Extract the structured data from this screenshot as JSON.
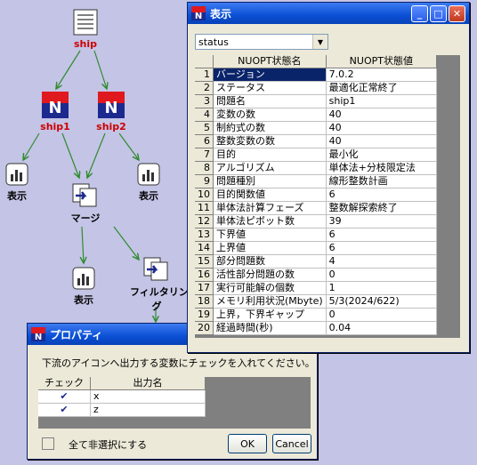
{
  "nodes": {
    "ship": "ship",
    "ship1": "ship1",
    "ship2": "ship2",
    "display_left": "表示",
    "display_right": "表示",
    "merge": "マージ",
    "display_bottom": "表示",
    "filtering_line1": "フィルタリン",
    "filtering_line2": "グ"
  },
  "display_window": {
    "title": "表示",
    "dropdown_value": "status",
    "columns": [
      "NUOPT状態名",
      "NUOPT状態値"
    ],
    "rows": [
      {
        "n": "1",
        "name": "バージョン",
        "value": "7.0.2"
      },
      {
        "n": "2",
        "name": "ステータス",
        "value": "最適化正常終了"
      },
      {
        "n": "3",
        "name": "問題名",
        "value": "ship1"
      },
      {
        "n": "4",
        "name": "変数の数",
        "value": "40"
      },
      {
        "n": "5",
        "name": "制約式の数",
        "value": "40"
      },
      {
        "n": "6",
        "name": "整数変数の数",
        "value": "40"
      },
      {
        "n": "7",
        "name": "目的",
        "value": "最小化"
      },
      {
        "n": "8",
        "name": "アルゴリズム",
        "value": "単体法+分枝限定法"
      },
      {
        "n": "9",
        "name": "問題種別",
        "value": "線形整数計画"
      },
      {
        "n": "10",
        "name": "目的関数値",
        "value": "6"
      },
      {
        "n": "11",
        "name": "単体法計算フェーズ",
        "value": "整数解探索終了"
      },
      {
        "n": "12",
        "name": "単体法ピボット数",
        "value": "39"
      },
      {
        "n": "13",
        "name": "下界値",
        "value": "6"
      },
      {
        "n": "14",
        "name": "上界値",
        "value": "6"
      },
      {
        "n": "15",
        "name": "部分問題数",
        "value": "4"
      },
      {
        "n": "16",
        "name": "活性部分問題の数",
        "value": "0"
      },
      {
        "n": "17",
        "name": "実行可能解の個数",
        "value": "1"
      },
      {
        "n": "18",
        "name": "メモリ利用状況(Mbyte)",
        "value": "5/3(2024/622)"
      },
      {
        "n": "19",
        "name": "上界，下界ギャップ",
        "value": "0"
      },
      {
        "n": "20",
        "name": "経過時間(秒)",
        "value": "0.04"
      }
    ]
  },
  "property_window": {
    "title": "プロパティ",
    "instruction": "下流のアイコンへ出力する変数にチェックを入れてください。",
    "columns": [
      "チェック",
      "出力名"
    ],
    "rows": [
      {
        "check": "✔",
        "name": "x"
      },
      {
        "check": "✔",
        "name": "z"
      }
    ],
    "deselect_all": "全て非選択にする",
    "ok": "OK",
    "cancel": "Cancel"
  },
  "colors": {
    "background": "#c4c4e6",
    "titlebar": "#0a4fd4",
    "node_label": "#cc0000",
    "arrow": "#2e8b2e",
    "selected": "#0a246a"
  }
}
